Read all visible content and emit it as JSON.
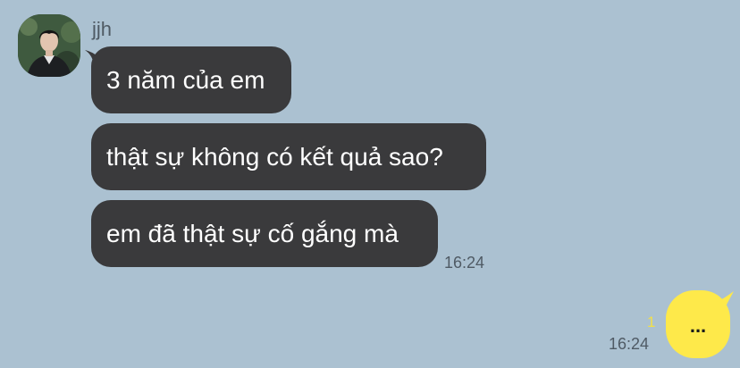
{
  "chat": {
    "sender_name": "jjh",
    "incoming_messages": [
      "3 năm của em",
      "thật sự không có kết quả sao?",
      "em đã thật sự cố gắng mà"
    ],
    "incoming_time": "16:24",
    "outgoing_message": "...",
    "outgoing_unread_count": "1",
    "outgoing_time": "16:24"
  },
  "colors": {
    "background": "#abc1d1",
    "incoming_bubble": "#3a3a3c",
    "outgoing_bubble": "#fee94a",
    "unread_count": "#f2e04a"
  },
  "icons": {
    "avatar": "profile-photo"
  }
}
